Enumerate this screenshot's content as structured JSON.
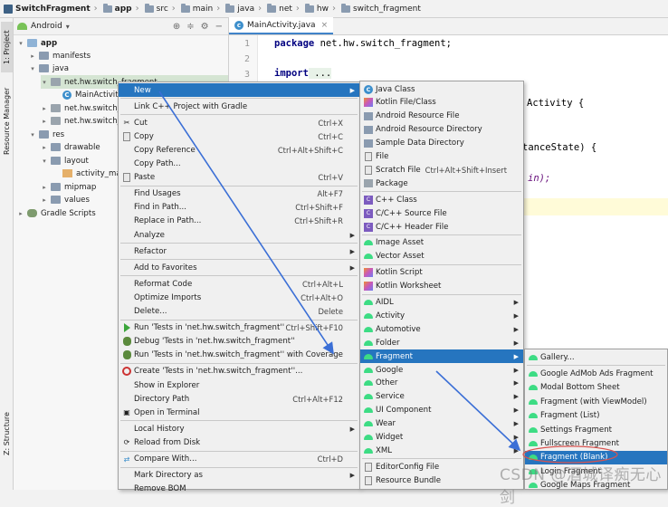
{
  "breadcrumb": [
    "SwitchFragment",
    "app",
    "src",
    "main",
    "java",
    "net",
    "hw",
    "switch_fragment"
  ],
  "left_strip": {
    "project_tab": "1: Project",
    "resource_manager_tab": "Resource Manager",
    "structure_tab": "Z: Structure"
  },
  "project_panel": {
    "view_mode": "Android",
    "tree": [
      {
        "label": "app",
        "level": 0,
        "icon": "module-folder-icon",
        "expanded": true
      },
      {
        "label": "manifests",
        "level": 1,
        "icon": "folder-icon",
        "expanded": false
      },
      {
        "label": "java",
        "level": 1,
        "icon": "folder-icon",
        "expanded": true
      },
      {
        "label": "net.hw.switch_fragment",
        "level": 2,
        "icon": "package-icon",
        "expanded": true,
        "selected": true
      },
      {
        "label": "MainActivity",
        "level": 3,
        "icon": "class-icon"
      },
      {
        "label": "net.hw.switch_f",
        "level": 2,
        "icon": "package-icon",
        "expanded": false
      },
      {
        "label": "net.hw.switch_f",
        "level": 2,
        "icon": "package-icon",
        "expanded": false
      },
      {
        "label": "res",
        "level": 1,
        "icon": "resource-folder-icon",
        "expanded": true
      },
      {
        "label": "drawable",
        "level": 2,
        "icon": "folder-icon",
        "expanded": false
      },
      {
        "label": "layout",
        "level": 2,
        "icon": "folder-icon",
        "expanded": true
      },
      {
        "label": "activity_mai",
        "level": 3,
        "icon": "xml-icon"
      },
      {
        "label": "mipmap",
        "level": 2,
        "icon": "folder-icon",
        "expanded": false
      },
      {
        "label": "values",
        "level": 2,
        "icon": "folder-icon",
        "expanded": false
      },
      {
        "label": "Gradle Scripts",
        "level": 0,
        "icon": "gradle-icon",
        "expanded": false
      }
    ]
  },
  "editor": {
    "tab_label": "MainActivity.java",
    "line_numbers": [
      "1",
      "2",
      "3"
    ],
    "code": {
      "line1_kw": "package",
      "line1_rest": " net.hw.switch_fragment;",
      "line3_kw": "import",
      "line3_rest": " ...",
      "frag_activity": "Activity {",
      "frag_state": "tanceState) {",
      "frag_in": "in);"
    }
  },
  "context_menu": [
    {
      "label": "New",
      "submenu": true,
      "highlighted": true
    },
    {
      "sep": true
    },
    {
      "label": "Link C++ Project with Gradle"
    },
    {
      "sep": true
    },
    {
      "label": "Cut",
      "shortcut": "Ctrl+X",
      "icon": "cut-icon"
    },
    {
      "label": "Copy",
      "shortcut": "Ctrl+C",
      "icon": "copy-icon"
    },
    {
      "label": "Copy Reference",
      "shortcut": "Ctrl+Alt+Shift+C"
    },
    {
      "label": "Copy Path...",
      "shortcut": ""
    },
    {
      "label": "Paste",
      "shortcut": "Ctrl+V",
      "icon": "paste-icon"
    },
    {
      "sep": true
    },
    {
      "label": "Find Usages",
      "shortcut": "Alt+F7"
    },
    {
      "label": "Find in Path...",
      "shortcut": "Ctrl+Shift+F"
    },
    {
      "label": "Replace in Path...",
      "shortcut": "Ctrl+Shift+R"
    },
    {
      "label": "Analyze",
      "submenu": true
    },
    {
      "sep": true
    },
    {
      "label": "Refactor",
      "submenu": true
    },
    {
      "sep": true
    },
    {
      "label": "Add to Favorites",
      "submenu": true
    },
    {
      "sep": true
    },
    {
      "label": "Reformat Code",
      "shortcut": "Ctrl+Alt+L"
    },
    {
      "label": "Optimize Imports",
      "shortcut": "Ctrl+Alt+O"
    },
    {
      "label": "Delete...",
      "shortcut": "Delete"
    },
    {
      "sep": true
    },
    {
      "label": "Run 'Tests in 'net.hw.switch_fragment''",
      "shortcut": "Ctrl+Shift+F10",
      "icon": "run-icon"
    },
    {
      "label": "Debug 'Tests in 'net.hw.switch_fragment''",
      "icon": "debug-icon"
    },
    {
      "label": "Run 'Tests in 'net.hw.switch_fragment'' with Coverage",
      "icon": "coverage-icon"
    },
    {
      "sep": true
    },
    {
      "label": "Create 'Tests in 'net.hw.switch_fragment''...",
      "icon": "create-test-icon"
    },
    {
      "label": "Show in Explorer"
    },
    {
      "label": "Directory Path",
      "shortcut": "Ctrl+Alt+F12"
    },
    {
      "label": "Open in Terminal",
      "icon": "terminal-icon"
    },
    {
      "sep": true
    },
    {
      "label": "Local History",
      "submenu": true
    },
    {
      "label": "Reload from Disk",
      "icon": "reload-icon"
    },
    {
      "sep": true
    },
    {
      "label": "Compare With...",
      "shortcut": "Ctrl+D",
      "icon": "compare-icon"
    },
    {
      "sep": true
    },
    {
      "label": "Mark Directory as",
      "submenu": true
    },
    {
      "label": "Remove BOM"
    }
  ],
  "new_submenu": [
    {
      "label": "Java Class",
      "icon": "java-class-icon"
    },
    {
      "label": "Kotlin File/Class",
      "icon": "kotlin-icon"
    },
    {
      "label": "Android Resource File",
      "icon": "android-resource-file-icon"
    },
    {
      "label": "Android Resource Directory",
      "icon": "resource-directory-icon"
    },
    {
      "label": "Sample Data Directory",
      "icon": "sample-data-icon"
    },
    {
      "label": "File",
      "icon": "file-icon"
    },
    {
      "label": "Scratch File",
      "shortcut": "Ctrl+Alt+Shift+Insert",
      "icon": "scratch-file-icon"
    },
    {
      "label": "Package",
      "icon": "package-icon"
    },
    {
      "sep": true
    },
    {
      "label": "C++ Class",
      "icon": "cpp-class-icon"
    },
    {
      "label": "C/C++ Source File",
      "icon": "cpp-source-icon"
    },
    {
      "label": "C/C++ Header File",
      "icon": "cpp-header-icon"
    },
    {
      "sep": true
    },
    {
      "label": "Image Asset",
      "icon": "android-icon"
    },
    {
      "label": "Vector Asset",
      "icon": "android-icon"
    },
    {
      "sep": true
    },
    {
      "label": "Kotlin Script",
      "icon": "kotlin-icon"
    },
    {
      "label": "Kotlin Worksheet",
      "icon": "kotlin-icon"
    },
    {
      "sep": true
    },
    {
      "label": "AIDL",
      "submenu": true,
      "icon": "android-icon"
    },
    {
      "label": "Activity",
      "submenu": true,
      "icon": "android-icon"
    },
    {
      "label": "Automotive",
      "submenu": true,
      "icon": "android-icon"
    },
    {
      "label": "Folder",
      "submenu": true,
      "icon": "android-icon"
    },
    {
      "label": "Fragment",
      "submenu": true,
      "highlighted": true,
      "icon": "android-icon"
    },
    {
      "label": "Google",
      "submenu": true,
      "icon": "android-icon"
    },
    {
      "label": "Other",
      "submenu": true,
      "icon": "android-icon"
    },
    {
      "label": "Service",
      "submenu": true,
      "icon": "android-icon"
    },
    {
      "label": "UI Component",
      "submenu": true,
      "icon": "android-icon"
    },
    {
      "label": "Wear",
      "submenu": true,
      "icon": "android-icon"
    },
    {
      "label": "Widget",
      "submenu": true,
      "icon": "android-icon"
    },
    {
      "label": "XML",
      "submenu": true,
      "icon": "android-icon"
    },
    {
      "sep": true
    },
    {
      "label": "EditorConfig File",
      "icon": "editorconfig-icon"
    },
    {
      "label": "Resource Bundle",
      "icon": "resource-bundle-icon"
    }
  ],
  "fragment_submenu": [
    {
      "label": "Gallery...",
      "icon": "android-icon"
    },
    {
      "sep": true
    },
    {
      "label": "Google AdMob Ads Fragment",
      "icon": "android-icon"
    },
    {
      "label": "Modal Bottom Sheet",
      "icon": "android-icon"
    },
    {
      "label": "Fragment (with ViewModel)",
      "icon": "android-icon"
    },
    {
      "label": "Fragment (List)",
      "icon": "android-icon"
    },
    {
      "label": "Settings Fragment",
      "icon": "android-icon"
    },
    {
      "label": "Fullscreen Fragment",
      "icon": "android-icon"
    },
    {
      "label": "Fragment (Blank)",
      "icon": "android-icon",
      "highlighted": true
    },
    {
      "label": "Login Fragment",
      "icon": "android-icon"
    },
    {
      "label": "Google Maps Fragment",
      "icon": "android-icon"
    }
  ],
  "watermark": "CSDN @酒城译痴无心剑",
  "colors": {
    "highlight": "#2675bf",
    "arrow": "#3b6fd6",
    "selection": "#d5e5d3",
    "keyword": "#000080"
  }
}
